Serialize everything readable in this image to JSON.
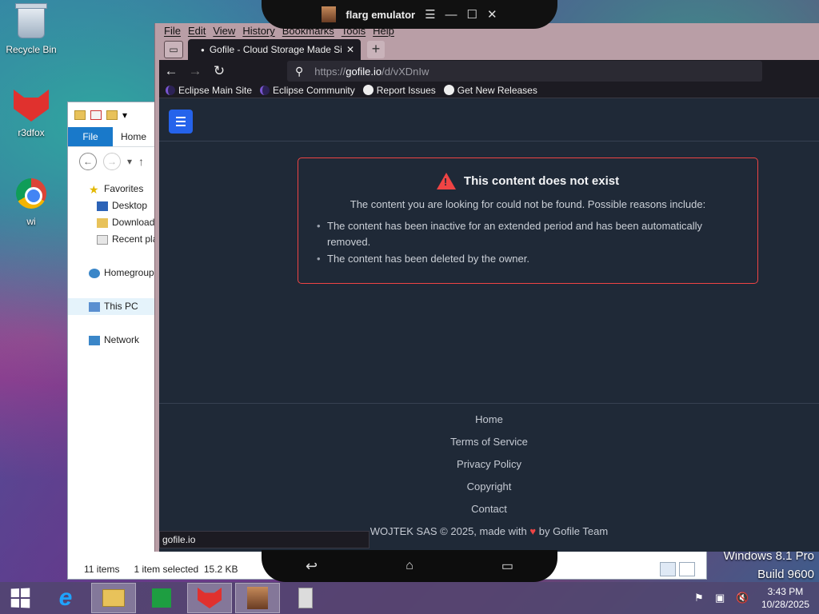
{
  "desktop": {
    "icons": [
      "Recycle Bin",
      "r3dfox",
      "wi"
    ],
    "watermark": [
      "Windows 8.1 Pro",
      "Build 9600"
    ]
  },
  "explorer": {
    "tabs": [
      "File",
      "Home"
    ],
    "nav_items": [
      "Favorites",
      "Desktop",
      "Downloads",
      "Recent places",
      "Homegroup",
      "This PC",
      "Network"
    ],
    "status_count": "11 items",
    "status_selected": "1 item selected  15.2 KB"
  },
  "emulator": {
    "title": "flarg emulator",
    "menu_glyph": "☰",
    "min_glyph": "—",
    "max_glyph": "☐",
    "close_glyph": "✕"
  },
  "browser": {
    "menus": [
      "File",
      "Edit",
      "View",
      "History",
      "Bookmarks",
      "Tools",
      "Help"
    ],
    "tab_title": "Gofile - Cloud Storage Made Simple",
    "url_prefix": "https://",
    "url_host": "gofile.io",
    "url_path": "/d/vXDnIw",
    "bookmarks": [
      "Eclipse Main Site",
      "Eclipse Community",
      "Report Issues",
      "Get New Releases"
    ],
    "status_tip": "gofile.io"
  },
  "page": {
    "error_title": "This content does not exist",
    "error_lead": "The content you are looking for could not be found. Possible reasons include:",
    "reasons": [
      "The content has been inactive for an extended period and has been automatically removed.",
      "The content has been deleted by the owner."
    ],
    "footer_links": [
      "Home",
      "Terms of Service",
      "Privacy Policy",
      "Copyright",
      "Contact"
    ],
    "footer_credit_prefix": "WOJTEK SAS © 2025, made with",
    "footer_credit_suffix": "by Gofile Team"
  },
  "taskbar": {
    "time": "3:43 PM",
    "date": "10/28/2025"
  }
}
